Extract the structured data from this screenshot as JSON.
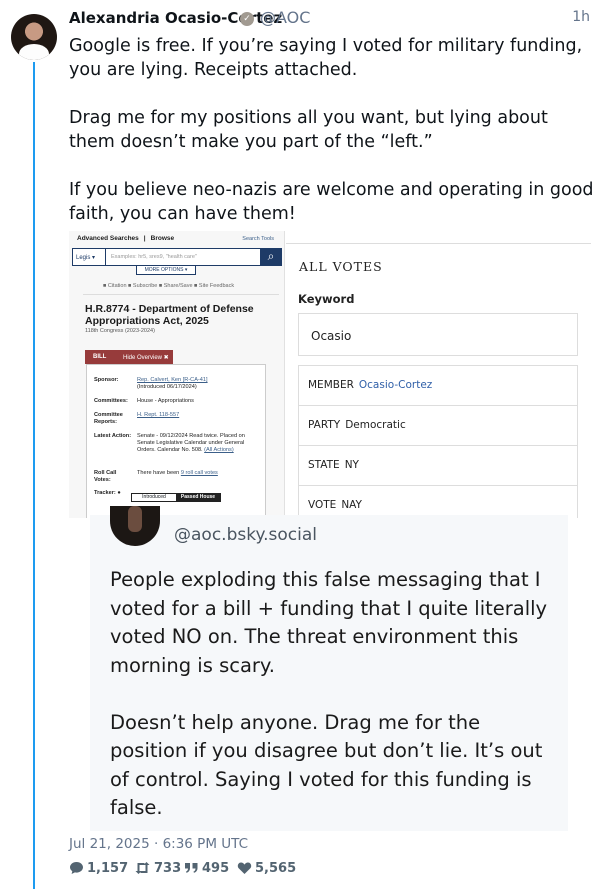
{
  "author": {
    "name": "Alexandria Ocasio-Cortez",
    "handle": "@AOC",
    "time": "1h"
  },
  "tweet": {
    "text": "Google is free. If you’re saying I voted for military funding, you are lying. Receipts attached.\n\nDrag me for my positions all you want, but lying about them doesn’t make you part of the “left.”\n\nIf you believe neo-nazis are welcome and operating in good faith, you can have them!"
  },
  "media_left": {
    "nav": [
      "Advanced Searches",
      "Browse"
    ],
    "tools": "Search Tools",
    "select_value": "Legis",
    "search_placeholder": "Examples: hr5, sres9, \"health care\"",
    "more_options": "MORE OPTIONS",
    "actions": [
      "Citation",
      "Subscribe",
      "Share/Save",
      "Site Feedback"
    ],
    "bill_title": "H.R.8774 - Department of Defense Appropriations Act, 2025",
    "congress": "118th Congress (2023-2024)",
    "tabs": [
      "BILL",
      "Hide Overview ✖"
    ],
    "rows": [
      {
        "label": "Sponsor:",
        "value": "Rep. Calvert, Ken [R-CA-41]",
        "sub": "(Introduced 06/17/2024)"
      },
      {
        "label": "Committees:",
        "value": "House - Appropriations"
      },
      {
        "label": "Committee Reports:",
        "value": "H. Rept. 118-557"
      },
      {
        "label": "Latest Action:",
        "value": "Senate - 09/12/2024 Read twice. Placed on Senate Legislative Calendar under General Orders. Calendar No. 508.",
        "link": "(All Actions)"
      },
      {
        "label": "Roll Call Votes:",
        "value": "There have been ",
        "link": "9 roll call votes"
      },
      {
        "label": "Tracker:",
        "value": ""
      }
    ],
    "tracker": [
      "Introduced",
      "Passed House"
    ]
  },
  "media_right": {
    "title": "ALL VOTES",
    "keyword_label": "Keyword",
    "keyword_value": "Ocasio",
    "rows": [
      {
        "key": "MEMBER",
        "value": "Ocasio-Cortez"
      },
      {
        "key": "PARTY",
        "value": "Democratic"
      },
      {
        "key": "STATE",
        "value": "NY"
      },
      {
        "key": "VOTE",
        "value": "NAY"
      }
    ]
  },
  "quote": {
    "handle": "@aoc.bsky.social",
    "text": "People exploding this false messaging that I voted for a bill + funding that I quite literally voted NO on. The threat environment this morning is scary.\n\nDoesn’t help anyone. Drag me for the position if you disagree but don’t lie. It’s out of control. Saying I voted for this funding is false."
  },
  "timestamp": "Jul 21, 2025 · 6:36 PM UTC",
  "stats": {
    "replies": "1,157",
    "retweets": "733",
    "quotes": "495",
    "likes": "5,565"
  },
  "colors": {
    "thread": "#1d9bf0",
    "muted": "#64748b",
    "congress_red": "#973b3b",
    "congress_navy": "#1e3b67"
  }
}
